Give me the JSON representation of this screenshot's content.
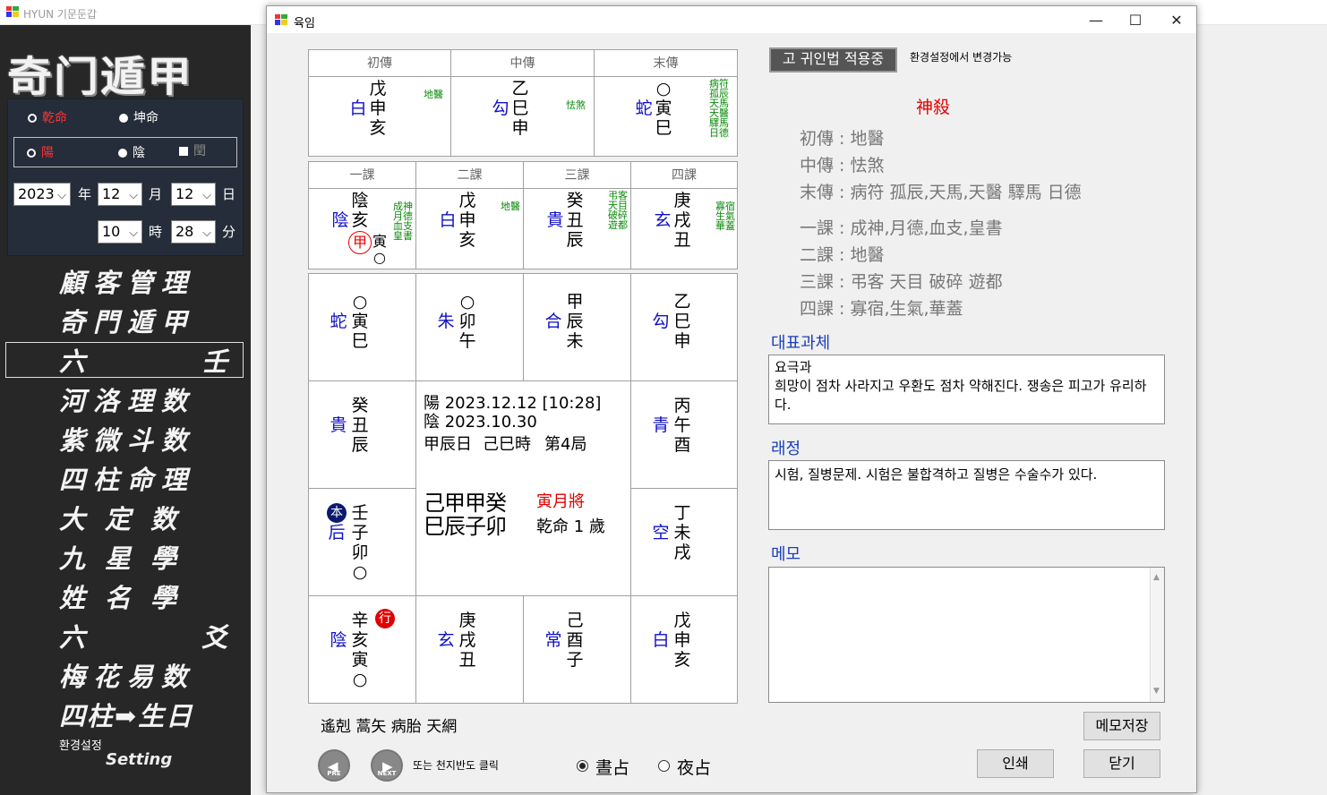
{
  "app": {
    "title": "HYUN 기문둔갑"
  },
  "sidebar": {
    "logo": "奇门遁甲",
    "gender": {
      "male": "乾命",
      "female": "坤命"
    },
    "calendar": {
      "solar": "陽",
      "lunar": "陰",
      "leap": "閏"
    },
    "date": {
      "year": "2023",
      "year_unit": "年",
      "month": "12",
      "month_unit": "月",
      "day": "12",
      "day_unit": "日",
      "hour": "10",
      "hour_unit": "時",
      "minute": "28",
      "minute_unit": "分"
    },
    "menu": [
      "顧客管理",
      "奇門遁甲",
      "六 壬",
      "河洛理数",
      "紫微斗数",
      "四柱命理",
      "大定数",
      "九星學",
      "姓名學",
      "六 爻",
      "梅花易数",
      "四柱➡生日"
    ],
    "setting_ko": "환경설정",
    "setting_en": "Setting"
  },
  "dialog": {
    "title": "육임",
    "mode_button": "고 귀인법 적용중",
    "mode_note": "환경설정에서 변경가능",
    "sanjeon": [
      {
        "header": "初傳",
        "chars": [
          "戊",
          "申",
          "亥"
        ],
        "general": "白",
        "sinsal": [
          "地醫"
        ]
      },
      {
        "header": "中傳",
        "chars": [
          "乙",
          "巳",
          "申"
        ],
        "general": "勾",
        "sinsal": [
          "怯煞"
        ]
      },
      {
        "header": "末傳",
        "chars": [
          "○",
          "寅",
          "巳"
        ],
        "general": "蛇",
        "sinsal": [
          "病符",
          "孤辰",
          "天馬",
          "天醫",
          "驛馬",
          "日德"
        ]
      }
    ],
    "sagwa": [
      {
        "header": "一課",
        "chars": [
          "陰",
          "亥",
          "寅"
        ],
        "general": "陰",
        "stem_mark": "甲",
        "extra": "○",
        "sinsal": [
          "成神",
          "月德",
          "血支",
          "皇書"
        ]
      },
      {
        "header": "二課",
        "chars": [
          "戊",
          "申",
          "亥"
        ],
        "general": "白",
        "sinsal": [
          "地醫"
        ]
      },
      {
        "header": "三課",
        "chars": [
          "癸",
          "丑",
          "辰"
        ],
        "general": "貴",
        "sinsal": [
          "弔客",
          "天目",
          "破碎",
          "遊都"
        ]
      },
      {
        "header": "四課",
        "chars": [
          "庚",
          "戌",
          "丑"
        ],
        "general": "玄",
        "sinsal": [
          "寡宿",
          "生氣",
          "華蓋"
        ]
      }
    ],
    "board": {
      "top": [
        {
          "general": "蛇",
          "chars": [
            "○",
            "寅",
            "巳"
          ]
        },
        {
          "general": "朱",
          "chars": [
            "○",
            "卯",
            "午"
          ]
        },
        {
          "general": "合",
          "chars": [
            "甲",
            "辰",
            "未"
          ]
        },
        {
          "general": "勾",
          "chars": [
            "乙",
            "巳",
            "申"
          ]
        }
      ],
      "left": [
        {
          "general": "貴",
          "chars": [
            "癸",
            "丑",
            "辰"
          ]
        },
        {
          "general": "后",
          "chars": [
            "壬",
            "子",
            "卯",
            "○"
          ],
          "badge": "本"
        }
      ],
      "right": [
        {
          "general": "青",
          "chars": [
            "丙",
            "午",
            "酉"
          ]
        },
        {
          "general": "空",
          "chars": [
            "丁",
            "未",
            "戌"
          ]
        }
      ],
      "bottom": [
        {
          "general": "陰",
          "chars": [
            "辛",
            "亥",
            "寅",
            "○"
          ],
          "badge": "行"
        },
        {
          "general": "玄",
          "chars": [
            "庚",
            "戌",
            "丑"
          ]
        },
        {
          "general": "常",
          "chars": [
            "己",
            "酉",
            "子"
          ]
        },
        {
          "general": "白",
          "chars": [
            "戊",
            "申",
            "亥"
          ]
        }
      ],
      "center": {
        "solar": "陽  2023.12.12  [10:28]",
        "lunar": "陰  2023.10.30",
        "day": "甲辰日",
        "hour": "己巳時",
        "guk": "第4局",
        "pillars_top": "己甲甲癸",
        "pillars_bottom": "巳辰子卯",
        "wolmajang": "寅月將",
        "age": "乾命 1 歲"
      }
    },
    "bottom_text": "遙剋  蒿矢  病胎  天網",
    "nav": {
      "prev": "PRE",
      "next": "NEXT",
      "hint": "또는 천지반도 클릭"
    },
    "time_radio": {
      "day": "晝占",
      "night": "夜占"
    },
    "sinsal": {
      "title": "神殺",
      "lines": [
        "初傳 :  地醫",
        "中傳 :   怯煞",
        "末傳 : 病符  孤辰,天馬,天醫  驛馬  日德",
        "一課 :  成神,月德,血支,皇書",
        "二課 :  地醫",
        "三課 : 弔客  天目  破碎  遊都",
        "四課 :  寡宿,生氣,華蓋"
      ]
    },
    "representative": {
      "title": "대표과체",
      "line1": "요극과",
      "line2": "희망이 점차 사라지고 우환도 점차 약해진다. 쟁송은 피고가 유리하다."
    },
    "raejeong": {
      "title": "래정",
      "text": "시험, 질병문제. 시험은 불합격하고 질병은 수술수가 있다."
    },
    "memo": {
      "title": "메모",
      "value": ""
    },
    "buttons": {
      "save_memo": "메모저장",
      "print": "인쇄",
      "close": "닫기"
    }
  },
  "colors": {
    "general_blue": "#1010c8",
    "sinsal_green": "#0a8a0a",
    "sinsal_title_red": "#e00000",
    "badge_navy": "#0a1a6e",
    "badge_red": "#e00000"
  }
}
